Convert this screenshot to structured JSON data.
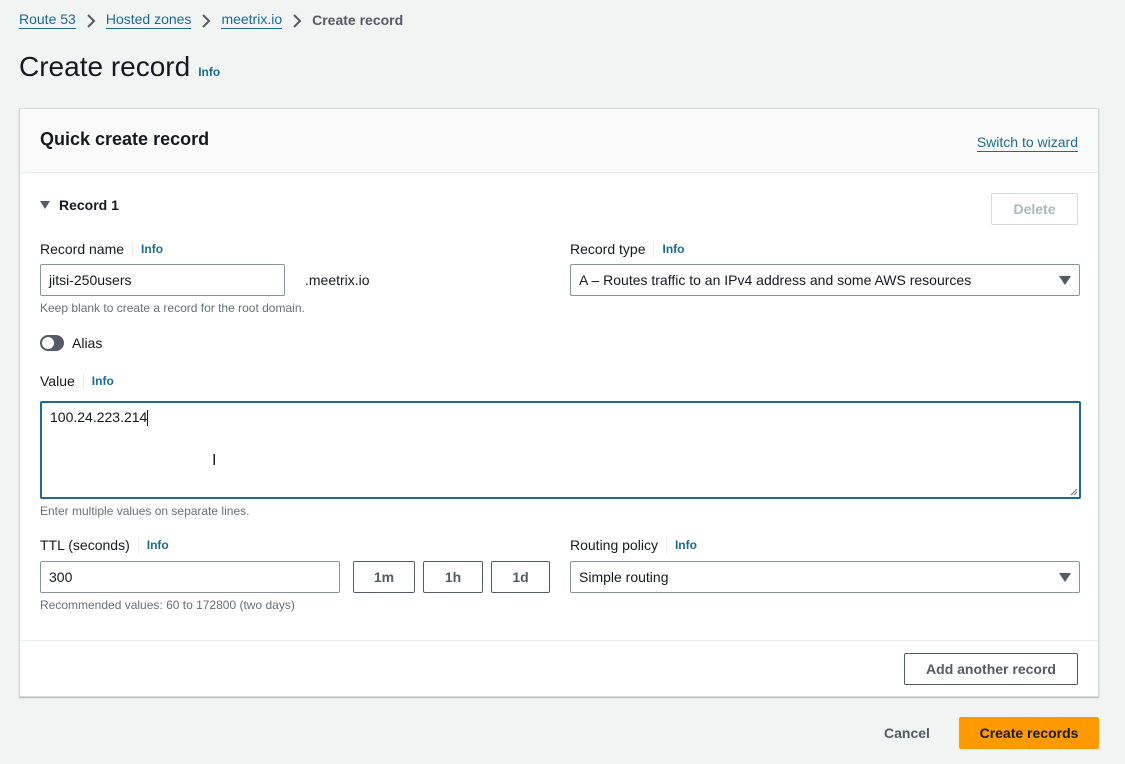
{
  "breadcrumb": {
    "items": [
      "Route 53",
      "Hosted zones",
      "meetrix.io"
    ],
    "current": "Create record"
  },
  "page": {
    "title": "Create record",
    "info": "Info"
  },
  "panel": {
    "title": "Quick create record",
    "switch_link": "Switch to wizard",
    "record_label": "Record 1",
    "delete_label": "Delete"
  },
  "record_name": {
    "label": "Record name",
    "info": "Info",
    "value": "jitsi-250users",
    "suffix": ".meetrix.io",
    "hint": "Keep blank to create a record for the root domain."
  },
  "record_type": {
    "label": "Record type",
    "info": "Info",
    "selected": "A – Routes traffic to an IPv4 address and some AWS resources"
  },
  "alias": {
    "label": "Alias",
    "enabled": false
  },
  "value": {
    "label": "Value",
    "info": "Info",
    "text": "100.24.223.214",
    "hint": "Enter multiple values on separate lines."
  },
  "ttl": {
    "label": "TTL (seconds)",
    "info": "Info",
    "value": "300",
    "presets": [
      "1m",
      "1h",
      "1d"
    ],
    "hint": "Recommended values: 60 to 172800 (two days)"
  },
  "routing_policy": {
    "label": "Routing policy",
    "info": "Info",
    "selected": "Simple routing"
  },
  "actions": {
    "add_another": "Add another record",
    "cancel": "Cancel",
    "create": "Create records"
  },
  "colors": {
    "link": "#1b6b93",
    "primary_button": "#ff9900",
    "focus_border": "#1b6b93"
  }
}
